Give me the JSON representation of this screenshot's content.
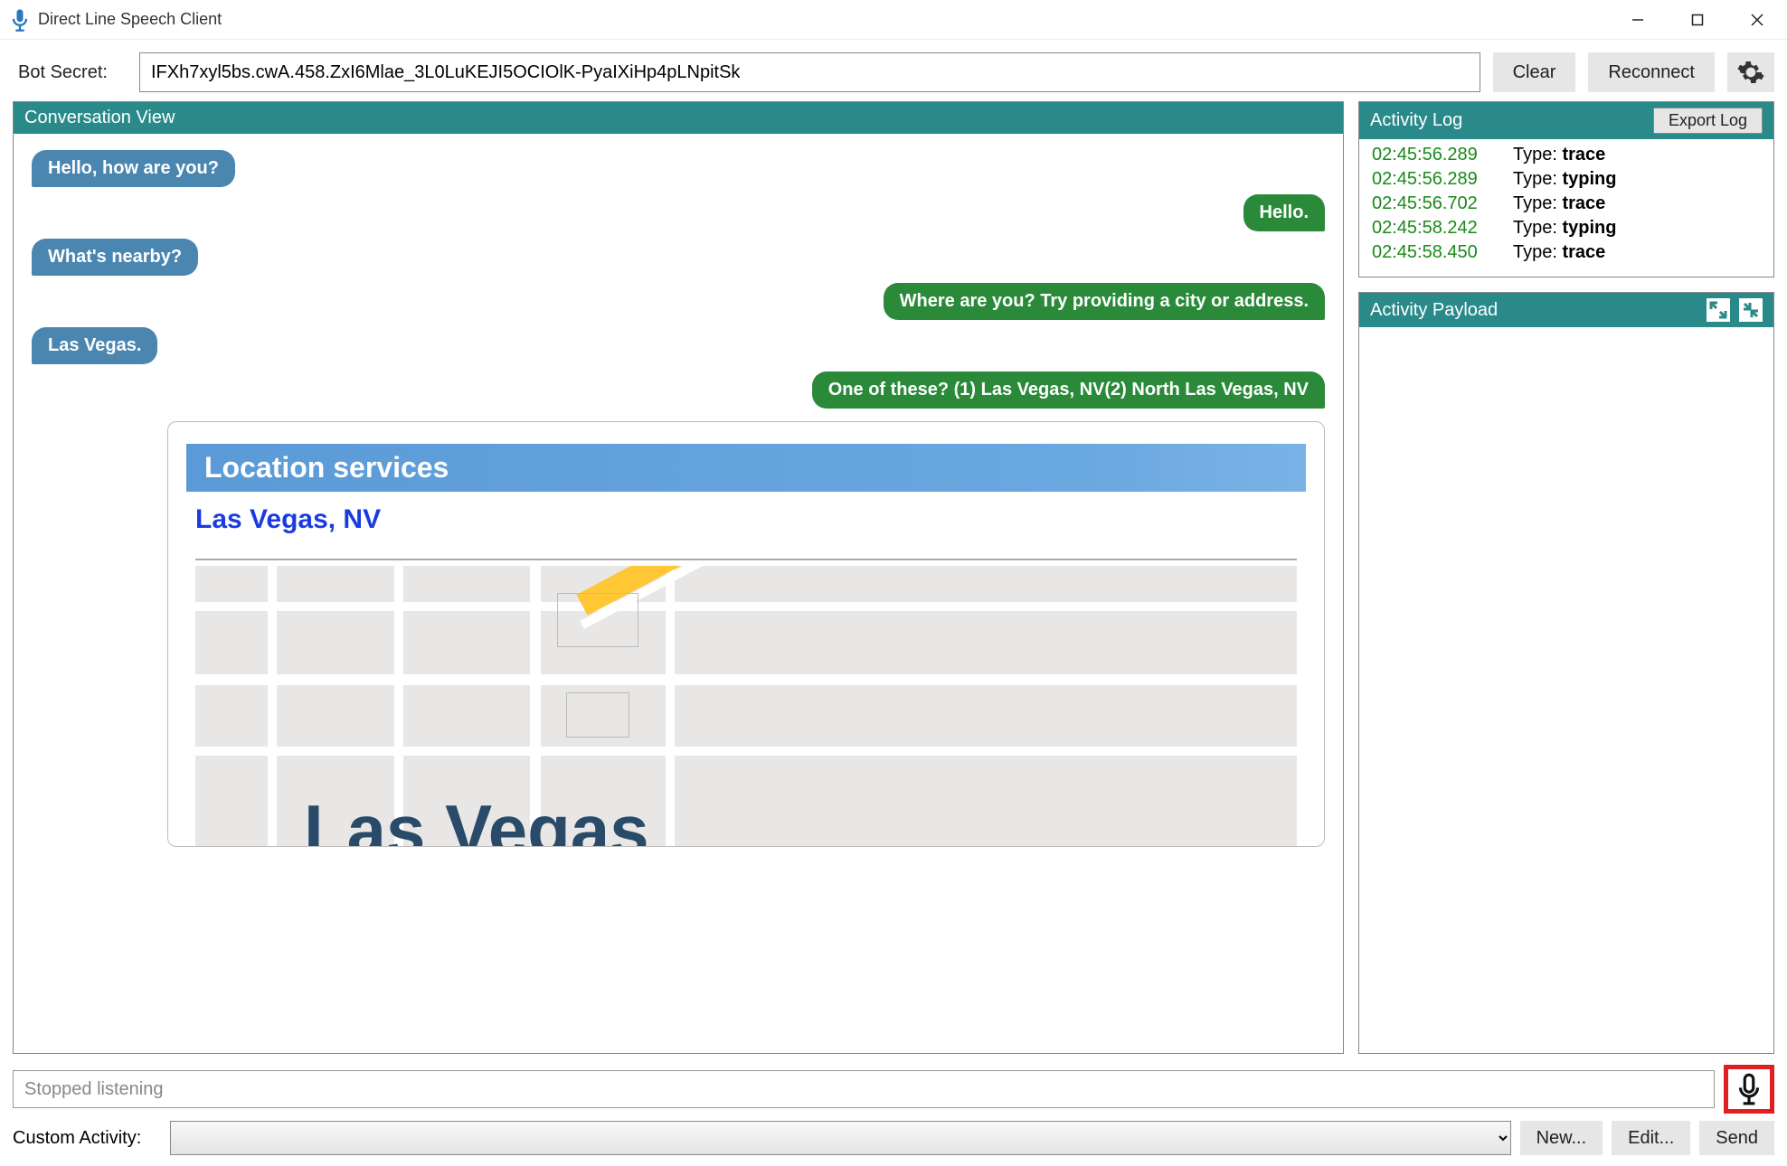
{
  "window": {
    "title": "Direct Line Speech Client"
  },
  "toolbar": {
    "bot_secret_label": "Bot Secret:",
    "bot_secret_value": "IFXh7xyl5bs.cwA.458.ZxI6Mlae_3L0LuKEJI5OCIOlK-PyaIXiHp4pLNpitSk",
    "clear_label": "Clear",
    "reconnect_label": "Reconnect"
  },
  "conversation": {
    "header": "Conversation View",
    "messages": [
      {
        "from": "user",
        "text": "Hello, how are you?"
      },
      {
        "from": "bot",
        "text": "Hello."
      },
      {
        "from": "user",
        "text": "What's nearby?"
      },
      {
        "from": "bot",
        "text": "Where are you? Try providing a city or address."
      },
      {
        "from": "user",
        "text": "Las Vegas."
      },
      {
        "from": "bot",
        "text": "One of these? (1) Las Vegas, NV(2) North Las Vegas, NV"
      }
    ],
    "card": {
      "heading": "Location services",
      "location": "Las Vegas, NV",
      "map_label": "Las Vegas"
    }
  },
  "activity_log": {
    "header": "Activity Log",
    "export_label": "Export Log",
    "type_prefix": "Type: ",
    "rows": [
      {
        "ts": "02:45:56.289",
        "type": "trace"
      },
      {
        "ts": "02:45:56.289",
        "type": "typing"
      },
      {
        "ts": "02:45:56.702",
        "type": "trace"
      },
      {
        "ts": "02:45:58.242",
        "type": "typing"
      },
      {
        "ts": "02:45:58.450",
        "type": "trace"
      }
    ]
  },
  "activity_payload": {
    "header": "Activity Payload"
  },
  "footer": {
    "status_text": "Stopped listening",
    "custom_activity_label": "Custom Activity:",
    "new_label": "New...",
    "edit_label": "Edit...",
    "send_label": "Send"
  }
}
